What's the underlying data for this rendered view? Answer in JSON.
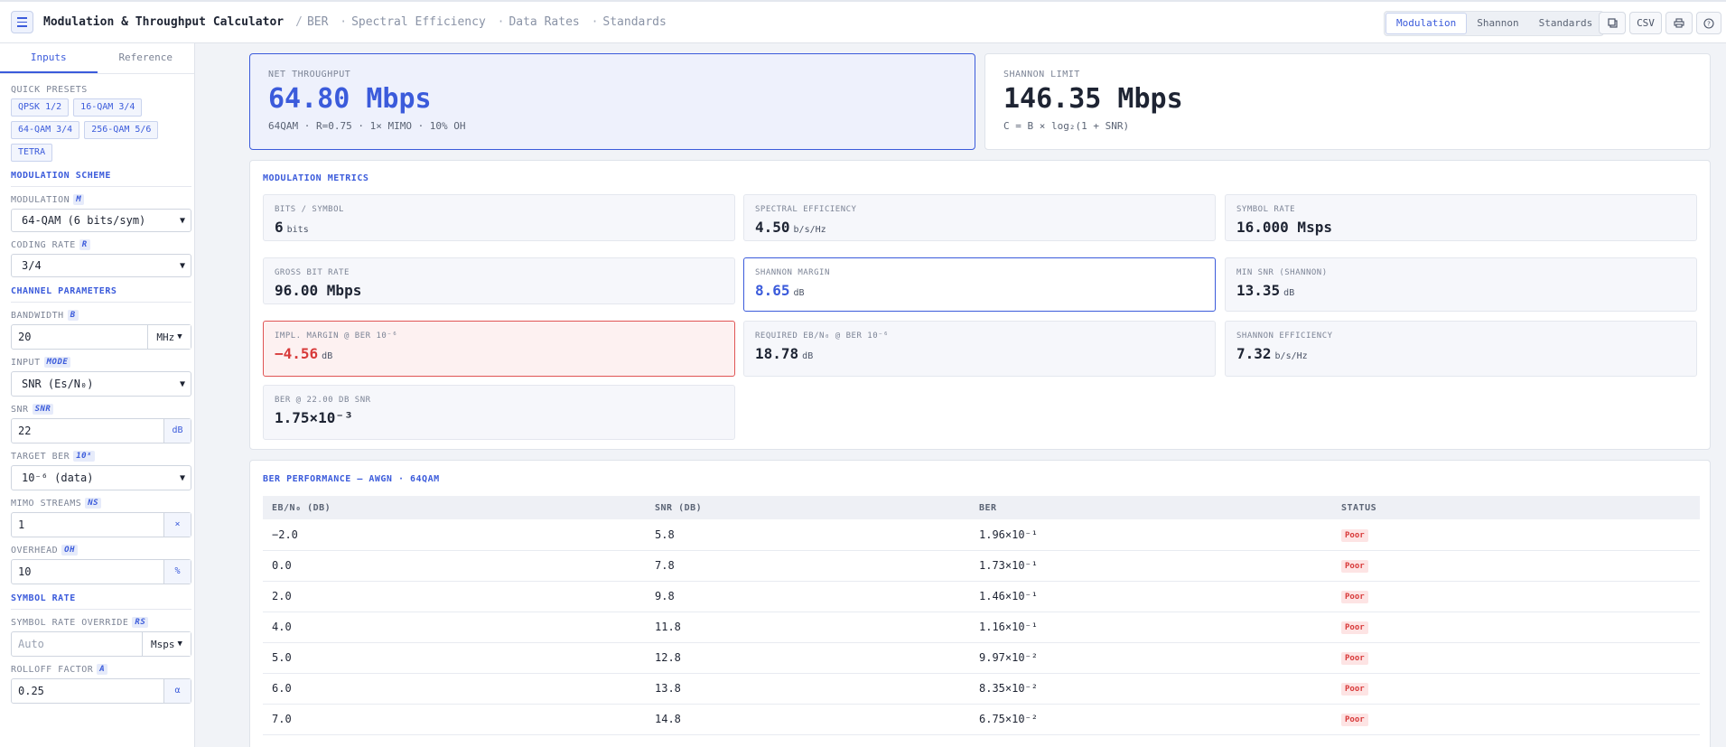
{
  "header": {
    "title": "Modulation & Throughput Calculator",
    "breadcrumb": [
      "BER",
      "Spectral Efficiency",
      "Data Rates",
      "Standards"
    ],
    "segments": [
      {
        "label": "Modulation",
        "active": true
      },
      {
        "label": "Shannon",
        "active": false
      },
      {
        "label": "Standards",
        "active": false
      }
    ],
    "actions": {
      "copy_icon": "copy-icon",
      "csv_label": "CSV",
      "print_icon": "print-icon",
      "help_icon": "help-icon"
    }
  },
  "sidebar": {
    "tabs": [
      {
        "label": "Inputs",
        "active": true
      },
      {
        "label": "Reference",
        "active": false
      }
    ],
    "presets_label": "QUICK PRESETS",
    "presets": [
      "QPSK 1/2",
      "16-QAM 3/4",
      "64-QAM 3/4",
      "256-QAM 5/6",
      "TETRA"
    ],
    "modulation_scheme_title": "MODULATION SCHEME",
    "modulation": {
      "label": "MODULATION",
      "tag": "M",
      "value": "64-QAM (6 bits/sym)"
    },
    "coding_rate": {
      "label": "CODING RATE",
      "tag": "R",
      "value": "3/4"
    },
    "channel_title": "CHANNEL PARAMETERS",
    "bandwidth": {
      "label": "BANDWIDTH",
      "tag": "B",
      "value": "20",
      "unit": "MHz"
    },
    "input_mode": {
      "label": "INPUT",
      "tag": "MODE",
      "value": "SNR (Es/N₀)"
    },
    "snr": {
      "label": "SNR",
      "tag": "SNR",
      "value": "22",
      "unit": "dB"
    },
    "target_ber": {
      "label": "TARGET BER",
      "tag": "10ˣ",
      "value": "10⁻⁶ (data)"
    },
    "mimo": {
      "label": "MIMO STREAMS",
      "tag": "NS",
      "value": "1",
      "unit": "×"
    },
    "overhead": {
      "label": "OVERHEAD",
      "tag": "OH",
      "value": "10",
      "unit": "%"
    },
    "symbol_rate_title": "SYMBOL RATE",
    "symbol_rate_override": {
      "label": "SYMBOL RATE OVERRIDE",
      "tag": "RS",
      "placeholder": "Auto",
      "unit": "Msps"
    },
    "rolloff": {
      "label": "ROLLOFF FACTOR",
      "tag": "A",
      "value": "0.25",
      "unit": "α"
    }
  },
  "hero": {
    "net": {
      "label": "NET THROUGHPUT",
      "value": "64.80 Mbps",
      "sub": "64QAM · R=0.75 · 1× MIMO · 10% OH"
    },
    "shannon": {
      "label": "SHANNON LIMIT",
      "value": "146.35 Mbps",
      "sub": "C = B × log₂(1 + SNR)"
    }
  },
  "metrics": {
    "title": "MODULATION METRICS",
    "items": [
      {
        "label": "BITS / SYMBOL",
        "value": "6",
        "unit": "bits"
      },
      {
        "label": "SPECTRAL EFFICIENCY",
        "value": "4.50",
        "unit": "b/s/Hz"
      },
      {
        "label": "SYMBOL RATE",
        "value": "16.000 Msps",
        "unit": ""
      },
      {
        "label": "GROSS BIT RATE",
        "value": "96.00 Mbps",
        "unit": ""
      },
      {
        "label": "SHANNON MARGIN",
        "value": "8.65",
        "unit": "dB"
      },
      {
        "label": "MIN SNR (SHANNON)",
        "value": "13.35",
        "unit": "dB"
      },
      {
        "label": "IMPL. MARGIN @ BER 10⁻⁶",
        "value": "−4.56",
        "unit": "dB"
      },
      {
        "label": "REQUIRED EB/N₀ @ BER 10⁻⁶",
        "value": "18.78",
        "unit": "dB"
      },
      {
        "label": "SHANNON EFFICIENCY",
        "value": "7.32",
        "unit": "b/s/Hz"
      },
      {
        "label": "BER @ 22.00 DB SNR",
        "value": "1.75×10⁻³",
        "unit": ""
      }
    ]
  },
  "ber_table": {
    "title": "BER PERFORMANCE — AWGN · 64QAM",
    "columns": [
      "EB/N₀ (DB)",
      "SNR (DB)",
      "BER",
      "STATUS"
    ],
    "rows": [
      {
        "ebno": "−2.0",
        "snr": "5.8",
        "ber": "1.96×10⁻¹",
        "status": "Poor"
      },
      {
        "ebno": "0.0",
        "snr": "7.8",
        "ber": "1.73×10⁻¹",
        "status": "Poor"
      },
      {
        "ebno": "2.0",
        "snr": "9.8",
        "ber": "1.46×10⁻¹",
        "status": "Poor"
      },
      {
        "ebno": "4.0",
        "snr": "11.8",
        "ber": "1.16×10⁻¹",
        "status": "Poor"
      },
      {
        "ebno": "5.0",
        "snr": "12.8",
        "ber": "9.97×10⁻²",
        "status": "Poor"
      },
      {
        "ebno": "6.0",
        "snr": "13.8",
        "ber": "8.35×10⁻²",
        "status": "Poor"
      },
      {
        "ebno": "7.0",
        "snr": "14.8",
        "ber": "6.75×10⁻²",
        "status": "Poor"
      }
    ]
  },
  "colors": {
    "accent": "#3b5bdb",
    "danger": "#d83a3a",
    "danger_bg": "#fdf1f1"
  }
}
